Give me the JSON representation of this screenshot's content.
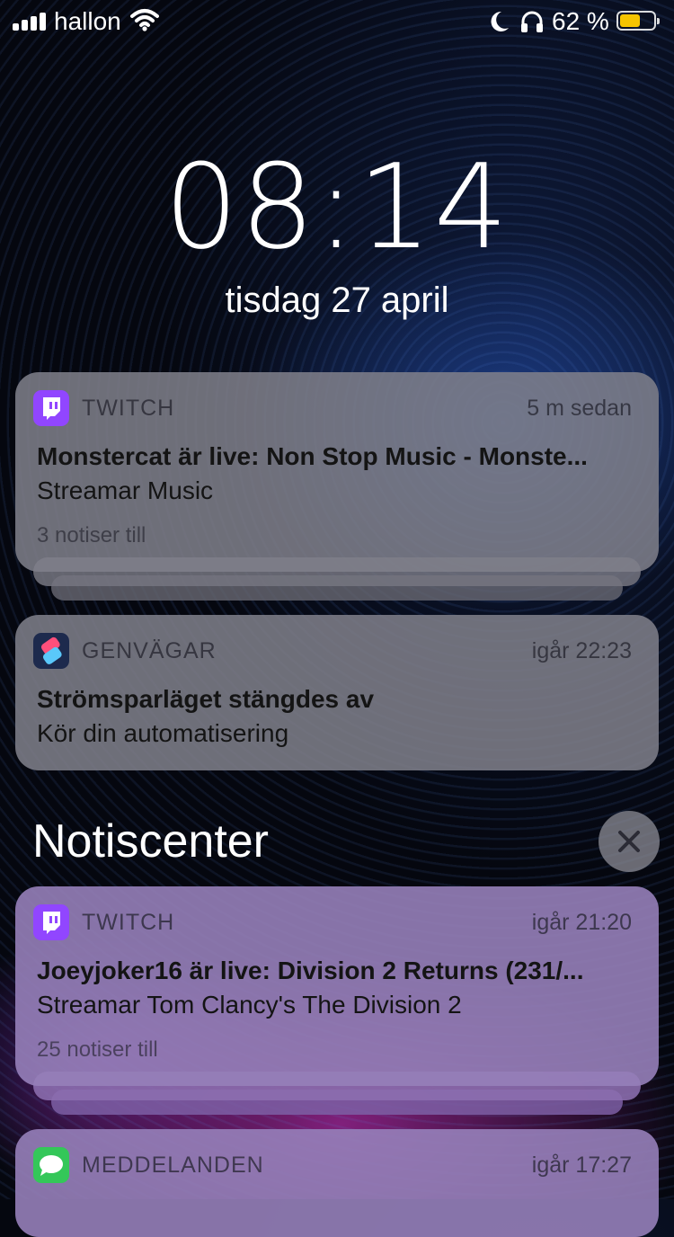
{
  "status_bar": {
    "carrier": "hallon",
    "battery_percent": "62 %",
    "battery_level": 0.62,
    "icons": [
      "signal-bars-icon",
      "wifi-icon",
      "moon-icon",
      "headphones-icon",
      "battery-icon"
    ]
  },
  "lock": {
    "time": "08:14",
    "date": "tisdag 27 april"
  },
  "notifications": [
    {
      "app": "TWITCH",
      "icon": "twitch-icon",
      "time": "5 m sedan",
      "title": "Monstercat är live: Non Stop Music - Monste...",
      "body": "Streamar Music",
      "more": "3 notiser till"
    },
    {
      "app": "GENVÄGAR",
      "icon": "shortcuts-icon",
      "time": "igår 22:23",
      "title": "Strömsparläget stängdes av",
      "body": "Kör din automatisering"
    }
  ],
  "notification_center": {
    "heading": "Notiscenter",
    "items": [
      {
        "app": "TWITCH",
        "icon": "twitch-icon",
        "time": "igår 21:20",
        "title": "Joeyjoker16 är live: Division 2 Returns (231/...",
        "body": "Streamar Tom Clancy's The Division 2",
        "more": "25 notiser till"
      },
      {
        "app": "MEDDELANDEN",
        "icon": "messages-icon",
        "time": "igår 17:27"
      }
    ]
  },
  "colors": {
    "twitch": "#9146ff",
    "messages": "#34c759",
    "battery": "#f5c400"
  }
}
